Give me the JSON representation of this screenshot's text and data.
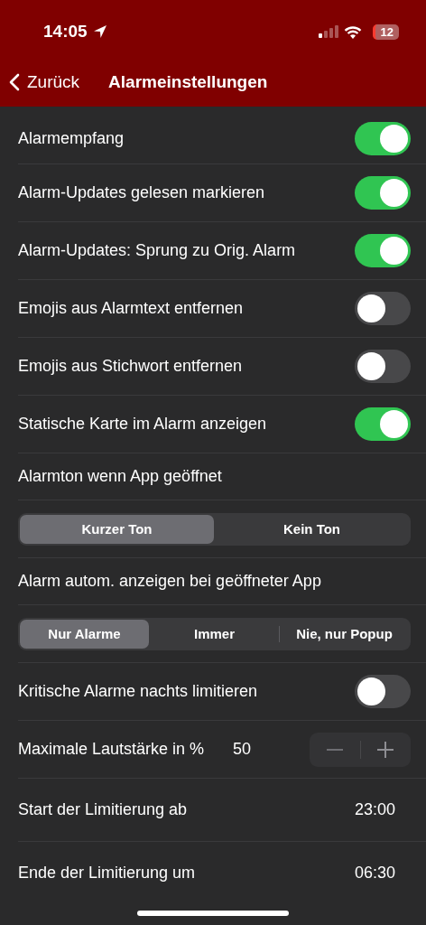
{
  "status_bar": {
    "time": "14:05",
    "battery": "12"
  },
  "nav": {
    "back": "Zurück",
    "title": "Alarmeinstellungen"
  },
  "rows": [
    {
      "kind": "toggle",
      "label": "Alarmempfang",
      "on": true
    },
    {
      "kind": "toggle",
      "label": "Alarm-Updates gelesen markieren",
      "on": true
    },
    {
      "kind": "toggle",
      "label": "Alarm-Updates: Sprung zu Orig. Alarm",
      "on": true
    },
    {
      "kind": "toggle",
      "label": "Emojis aus Alarmtext entfernen",
      "on": false
    },
    {
      "kind": "toggle",
      "label": "Emojis aus Stichwort entfernen",
      "on": false
    },
    {
      "kind": "toggle",
      "label": "Statische Karte im Alarm anzeigen",
      "on": true
    },
    {
      "kind": "label",
      "label": "Alarmton wenn App geöffnet"
    },
    {
      "kind": "segmented",
      "segments": [
        {
          "label": "Kurzer Ton",
          "selected": true
        },
        {
          "label": "Kein Ton",
          "selected": false
        }
      ]
    },
    {
      "kind": "label",
      "label": "Alarm autom. anzeigen bei geöffneter App"
    },
    {
      "kind": "segmented",
      "segments": [
        {
          "label": "Nur Alarme",
          "selected": true
        },
        {
          "label": "Immer",
          "selected": false
        },
        {
          "label": "Nie, nur Popup",
          "selected": false
        }
      ]
    },
    {
      "kind": "toggle",
      "label": "Kritische Alarme nachts limitieren",
      "on": false
    },
    {
      "kind": "stepper",
      "label": "Maximale Lautstärke in %",
      "value": "50"
    },
    {
      "kind": "value",
      "label": "Start der Limitierung ab",
      "value": "23:00"
    },
    {
      "kind": "value",
      "label": "Ende der Limitierung um",
      "value": "06:30"
    }
  ]
}
